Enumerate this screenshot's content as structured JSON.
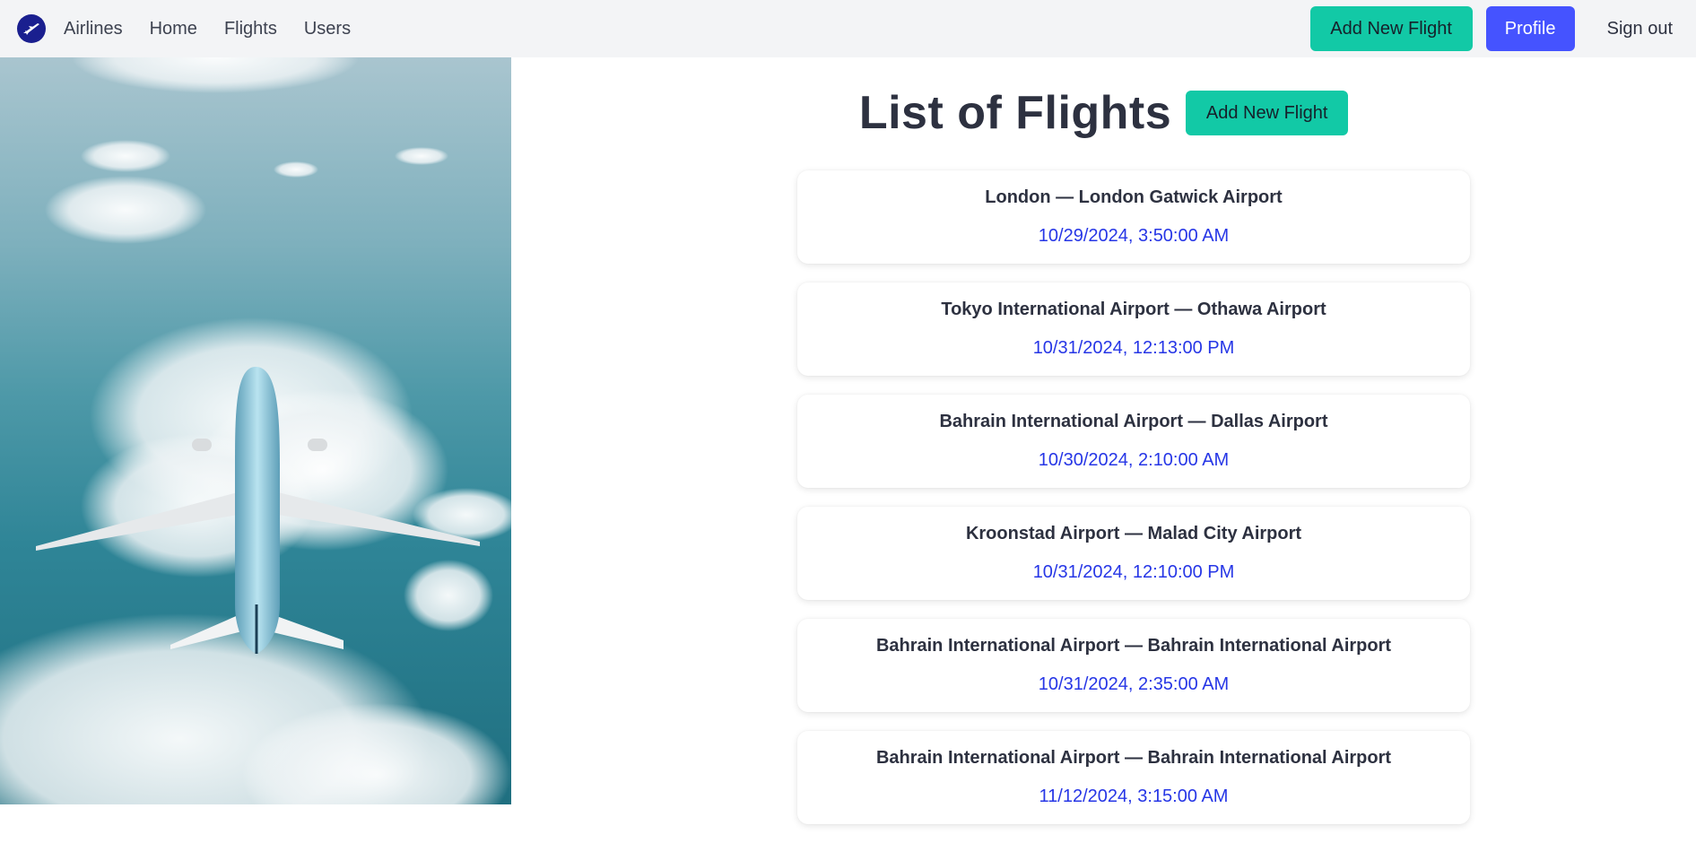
{
  "navbar": {
    "brand": "Airlines",
    "links": [
      "Home",
      "Flights",
      "Users"
    ],
    "add_flight_label": "Add New Flight",
    "profile_label": "Profile",
    "sign_out_label": "Sign out",
    "logo_icon": "plane-logo-icon"
  },
  "hero": {
    "image": "airplane-over-clouds-photo"
  },
  "main": {
    "title": "List of Flights",
    "add_flight_label": "Add New Flight",
    "flights": [
      {
        "route": "London — London Gatwick Airport",
        "date": "10/29/2024, 3:50:00 AM"
      },
      {
        "route": "Tokyo International Airport — Othawa Airport",
        "date": "10/31/2024, 12:13:00 PM"
      },
      {
        "route": "Bahrain International Airport — Dallas Airport",
        "date": "10/30/2024, 2:10:00 AM"
      },
      {
        "route": "Kroonstad Airport — Malad City Airport",
        "date": "10/31/2024, 12:10:00 PM"
      },
      {
        "route": "Bahrain International Airport — Bahrain International Airport",
        "date": "10/31/2024, 2:35:00 AM"
      },
      {
        "route": "Bahrain International Airport — Bahrain International Airport",
        "date": "11/12/2024, 3:15:00 AM"
      }
    ]
  },
  "colors": {
    "navbar_bg": "#f3f4f6",
    "teal_button": "#12c9a6",
    "blue_button": "#4553ff",
    "date_text": "#2636e6",
    "title_text": "#2d3140"
  }
}
